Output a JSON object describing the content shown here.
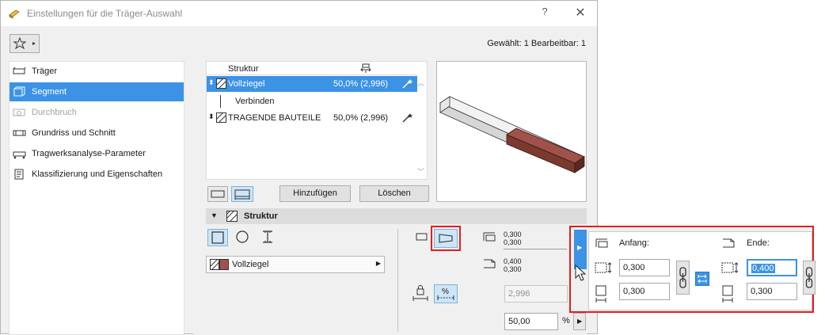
{
  "window": {
    "title": "Einstellungen für die Träger-Auswahl",
    "help": "?",
    "close": "✕"
  },
  "header": {
    "selected_count": "Gewählt: 1 Bearbeitbar: 1"
  },
  "sidebar": {
    "items": [
      {
        "label": "Träger",
        "state": "normal"
      },
      {
        "label": "Segment",
        "state": "active"
      },
      {
        "label": "Durchbruch",
        "state": "disabled"
      },
      {
        "label": "Grundriss und Schnitt",
        "state": "normal"
      },
      {
        "label": "Tragwerksanalyse-Parameter",
        "state": "normal"
      },
      {
        "label": "Klassifizierung und Eigenschaften",
        "state": "normal"
      }
    ]
  },
  "structure_list": {
    "header": "Struktur",
    "rows": [
      {
        "label": "Vollziegel",
        "value": "50,0% (2,996)",
        "selected": true
      },
      {
        "label": "Verbinden",
        "value": "",
        "selected": false
      },
      {
        "label": "TRAGENDE BAUTEILE",
        "value": "50,0% (2,996)",
        "selected": false
      }
    ]
  },
  "buttons": {
    "add": "Hinzufügen",
    "delete": "Löschen"
  },
  "section": {
    "title": "Struktur"
  },
  "material": {
    "label": "Vollziegel",
    "swatch_color": "#a0524a"
  },
  "dims": {
    "start_top": "0,300",
    "start_bottom": "0,300",
    "end_top": "0,400",
    "end_bottom": "0,300",
    "length": "2,996",
    "percent": "50,00",
    "percent_unit": "%"
  },
  "popup": {
    "start_label": "Anfang:",
    "end_label": "Ende:",
    "start_width": "0,300",
    "start_height": "0,300",
    "end_width": "0,400",
    "end_height": "0,300"
  },
  "colors": {
    "accent": "#3c93e6",
    "highlight": "#e02020",
    "beam_brick": "#7a3a2e"
  }
}
